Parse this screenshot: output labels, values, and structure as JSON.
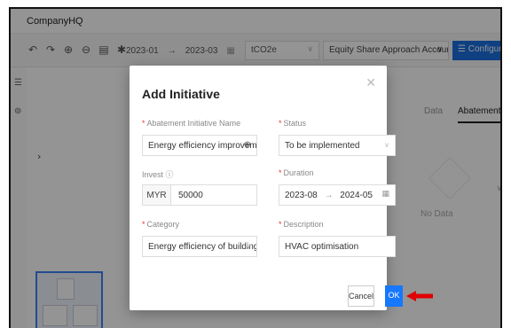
{
  "app": {
    "name": "CompanyHQ"
  },
  "toolbar": {
    "date_start": "2023-01",
    "date_sep": "→",
    "date_end": "2023-03",
    "unit": "tCO2e",
    "approach": "Equity Share Approach Accounting",
    "config_label": "Configuration",
    "config_icon": "☰"
  },
  "right_panel": {
    "tab_data": "Data",
    "tab_abatement": "Abatement",
    "no_data": "No Data"
  },
  "modal": {
    "title": "Add Initiative",
    "fields": {
      "abatement_name": {
        "label": "Abatement Initiative Name",
        "value": "Energy efficiency improvement"
      },
      "status": {
        "label": "Status",
        "value": "To be implemented"
      },
      "invest": {
        "label": "Invest",
        "currency": "MYR",
        "value": "50000"
      },
      "duration": {
        "label": "Duration",
        "start": "2023-08",
        "sep": "→",
        "end": "2024-05"
      },
      "category": {
        "label": "Category",
        "value": "Energy efficiency of buildings"
      },
      "description": {
        "label": "Description",
        "value": "HVAC optimisation"
      }
    },
    "cancel_label": "Cancel",
    "ok_label": "OK"
  },
  "icons": {
    "undo": "↶",
    "redo": "↷",
    "zoom_in": "⊕",
    "zoom_out": "⊖",
    "page": "▤",
    "settings": "✱",
    "calendar": "▦",
    "chevron": "∨",
    "close": "✕",
    "globe": "⊕",
    "info": "ⓘ",
    "menu": "☰",
    "target": "⊚",
    "expand": "›"
  },
  "colors": {
    "primary": "#1677ff",
    "required": "#e53935",
    "arrow": "#e00000"
  }
}
